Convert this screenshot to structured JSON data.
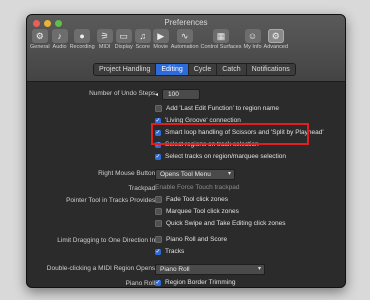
{
  "window": {
    "title": "Preferences",
    "lights": [
      "#ec5f57",
      "#e7b436",
      "#5fbf4a"
    ]
  },
  "toolbar": [
    {
      "label": "General",
      "icon": "⚙"
    },
    {
      "label": "Audio",
      "icon": "♪"
    },
    {
      "label": "Recording",
      "icon": "●"
    },
    {
      "label": "MIDI",
      "icon": "⚞"
    },
    {
      "label": "Display",
      "icon": "▭"
    },
    {
      "label": "Score",
      "icon": "♫"
    },
    {
      "label": "Movie",
      "icon": "▶"
    },
    {
      "label": "Automation",
      "icon": "∿"
    },
    {
      "label": "Control Surfaces",
      "icon": "▦"
    },
    {
      "label": "My Info",
      "icon": "☺"
    },
    {
      "label": "Advanced",
      "icon": "⚙"
    }
  ],
  "tabs": [
    "Project Handling",
    "Editing",
    "Cycle",
    "Catch",
    "Notifications"
  ],
  "selected_tab": "Editing",
  "undo": {
    "label": "Number of Undo Steps:",
    "value": "100"
  },
  "options": [
    {
      "text": "Add 'Last Edit Function' to region name",
      "checked": false
    },
    {
      "text": "'Living Groove' connection",
      "checked": true
    },
    {
      "text": "Smart loop handling of Scissors and 'Split by Playhead'",
      "checked": true
    },
    {
      "text": "Select regions on track selection",
      "checked": true
    },
    {
      "text": "Select tracks on region/marquee selection",
      "checked": true
    }
  ],
  "right_mouse": {
    "label": "Right Mouse Button:",
    "value": "Opens Tool Menu"
  },
  "trackpad": {
    "label": "Trackpad:",
    "value": "Enable Force Touch trackpad"
  },
  "pointer": {
    "label": "Pointer Tool in Tracks Provides:",
    "items": [
      {
        "text": "Fade Tool click zones",
        "checked": false
      },
      {
        "text": "Marquee Tool click zones",
        "checked": false
      },
      {
        "text": "Quick Swipe and Take Editing click zones",
        "checked": false
      }
    ]
  },
  "limit_drag": {
    "label": "Limit Dragging to One Direction In:",
    "items": [
      {
        "text": "Piano Roll and Score",
        "checked": false
      },
      {
        "text": "Tracks",
        "checked": true
      }
    ]
  },
  "double_click": {
    "label": "Double-clicking a MIDI Region Opens:",
    "value": "Piano Roll"
  },
  "piano_roll": {
    "label": "Piano Roll:",
    "item": {
      "text": "Region Border Trimming",
      "checked": true
    }
  },
  "colors": {
    "accent": "#2d6bd8",
    "highlight": "#e02020",
    "window_bg": "#2b2b2b"
  }
}
